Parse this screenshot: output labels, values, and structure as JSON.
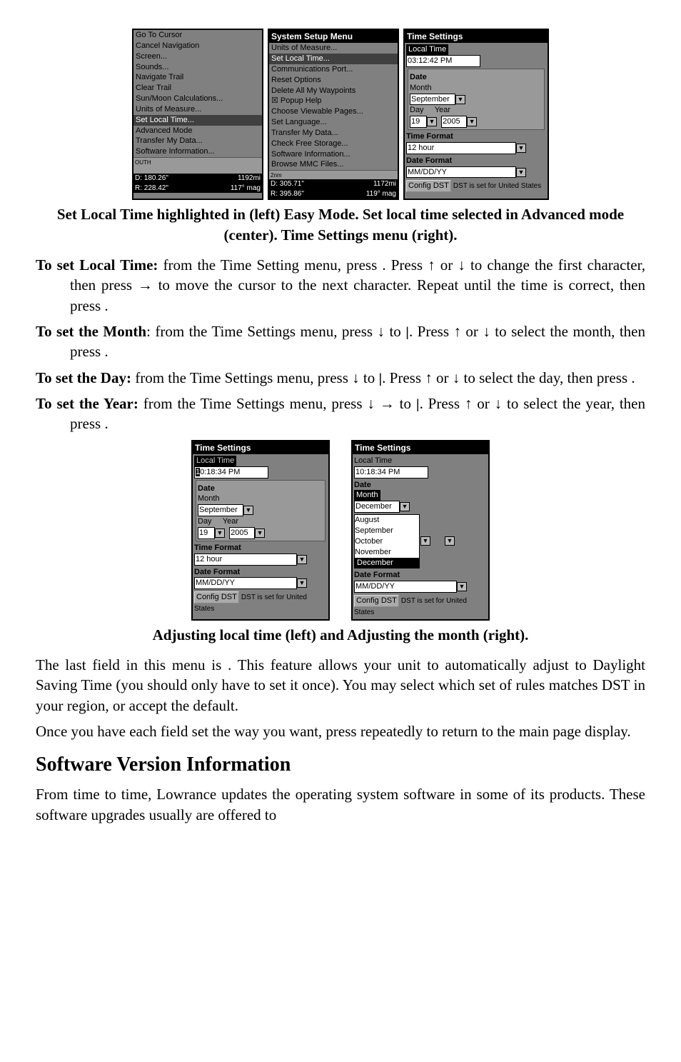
{
  "fig1": {
    "left_panel": {
      "items": [
        "Go To Cursor",
        "Cancel Navigation",
        "Screen...",
        "Sounds...",
        "Navigate Trail",
        "Clear Trail",
        "Sun/Moon Calculations...",
        "Units of Measure..."
      ],
      "highlight": "Set Local Time...",
      "items2": [
        "Advanced Mode",
        "Transfer My Data...",
        "Software Information..."
      ],
      "map": "OUTH",
      "status_d": "D: 180.26\"",
      "status_d2": "1192mi",
      "status_r": "R: 228.42\"",
      "status_r2": "117° mag"
    },
    "mid_panel": {
      "title": "System Setup Menu",
      "items": [
        "Units of Measure...",
        "Set Local Time...",
        "Communications Port...",
        "Reset Options",
        "Delete All My Waypoints",
        "☒ Popup Help",
        "Choose Viewable Pages...",
        "Set Language...",
        "Transfer My Data...",
        "Check Free Storage...",
        "Software Information...",
        "Browse MMC Files..."
      ],
      "map": "2nm",
      "status_d": "D: 305.71\"",
      "status_d2": "1172mi",
      "status_r": "R: 395.86\"",
      "status_r2": "119° mag"
    },
    "right_panel": {
      "title": "Time Settings",
      "local_time_hl": "Local Time",
      "time_val": "03:12:42 PM",
      "date_lbl": "Date",
      "month_lbl": "Month",
      "month_val": "September",
      "day_lbl": "Day",
      "year_lbl": "Year",
      "day_val": "19",
      "year_val": "2005",
      "tf_lbl": "Time Format",
      "tf_val": "12 hour",
      "df_lbl": "Date Format",
      "df_val": "MM/DD/YY",
      "btn": "Config DST",
      "btn_txt": "DST is set for United States"
    }
  },
  "caption1": "Set Local Time highlighted in (left) Easy Mode. Set local time selected in Advanced mode (center). Time Settings menu (right).",
  "p1a": "To set Local Time:",
  "p1b": " from the Time Setting menu, press ",
  "p1c": ". Press ↑ or ↓ to change the first character, then press → to move the cursor to the next character. Repeat until the time is correct, then press ",
  "p1d": ".",
  "p2a": "To set the Month",
  "p2b": ": from the Time Settings menu, press ↓ to ",
  "p2c": "|",
  "p2d": ". Press ↑ or ↓ to select the month, then press ",
  "p2e": ".",
  "p3a": "To set the Day:",
  "p3b": " from the Time Settings menu, press ↓ to ",
  "p3c": "|",
  "p3d": ". Press ↑ or ↓ to select the day, then press ",
  "p3e": ".",
  "p4a": "To set the Year:",
  "p4b": " from the Time Settings menu, press ↓ → to ",
  "p4c": "|",
  "p4d": ". Press ↑ or ↓ to select the year, then press ",
  "p4e": ".",
  "fig2": {
    "left": {
      "title": "Time Settings",
      "lt_lbl": "Local Time",
      "time_prefix": "1",
      "time_val": "0:18:34 PM",
      "date_lbl": "Date",
      "month_lbl": "Month",
      "month_val": "September",
      "day_lbl": "Day",
      "year_lbl": "Year",
      "day_val": "19",
      "year_val": "2005",
      "tf_lbl": "Time Format",
      "tf_val": "12 hour",
      "df_lbl": "Date Format",
      "df_val": "MM/DD/YY",
      "btn": "Config DST",
      "btn_txt": "DST is set for United States"
    },
    "right": {
      "title": "Time Settings",
      "lt_lbl": "Local Time",
      "time_val": "10:18:34 PM",
      "date_lbl": "Date",
      "month_hl": "Month",
      "month_val": "December",
      "opts": [
        "August",
        "September",
        "October",
        "November"
      ],
      "opt_hl": "December",
      "df_lbl": "Date Format",
      "df_val": "MM/DD/YY",
      "btn": "Config DST",
      "btn_txt": "DST is set for United States"
    }
  },
  "caption2": "Adjusting local time (left) and Adjusting the month (right).",
  "p5": "The last field in this menu is                     . This feature allows your unit to automatically adjust to Daylight Saving Time (you should only have to set it once). You may select which set of rules matches DST in your region, or accept the default.",
  "p6": "Once you have each field set the way you want, press           repeatedly to return to the main page display.",
  "h2": "Software Version Information",
  "p7": "From time to time, Lowrance updates the operating system software in some of its products. These software upgrades usually are offered to"
}
